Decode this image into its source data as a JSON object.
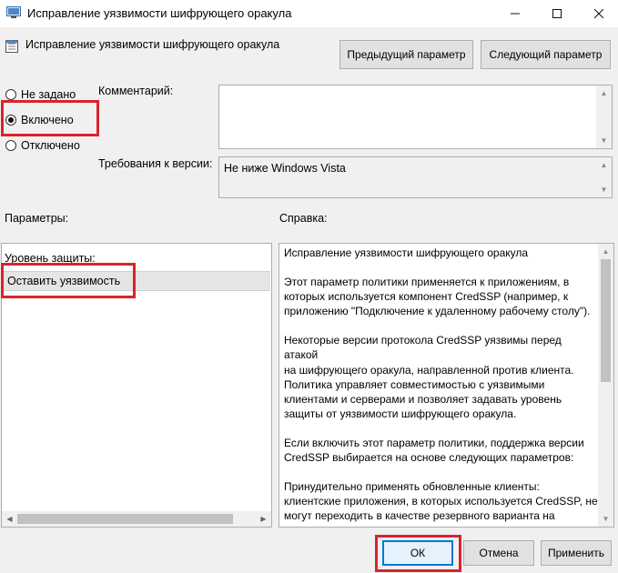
{
  "window": {
    "title": "Исправление уязвимости шифрующего оракула"
  },
  "header": {
    "title": "Исправление уязвимости шифрующего оракула",
    "prev_label": "Предыдущий параметр",
    "next_label": "Следующий параметр"
  },
  "state": {
    "options": [
      {
        "label": "Не задано",
        "checked": false
      },
      {
        "label": "Включено",
        "checked": true
      },
      {
        "label": "Отключено",
        "checked": false
      }
    ]
  },
  "comment": {
    "label": "Комментарий:",
    "value": ""
  },
  "requirements": {
    "label": "Требования к версии:",
    "value": "Не ниже Windows Vista"
  },
  "params": {
    "label": "Параметры:",
    "level_label": "Уровень защиты:",
    "level_value": "Оставить уязвимость"
  },
  "help": {
    "label": "Справка:",
    "paragraphs": [
      "Исправление уязвимости шифрующего оракула",
      "Этот параметр политики применяется к приложениям, в\nкоторых используется компонент CredSSP (например, к\nприложению \"Подключение к удаленному рабочему столу\").",
      "Некоторые версии протокола CredSSP уязвимы перед атакой\nна шифрующего оракула, направленной против клиента.\nПолитика управляет совместимостью с уязвимыми\nклиентами и серверами и позволяет задавать уровень\nзащиты от уязвимости шифрующего оракула.",
      "Если включить этот параметр политики, поддержка версии\nCredSSP выбирается на основе следующих параметров:",
      "Принудительно применять обновленные клиенты:\nклиентские приложения, в которых используется CredSSP, не\nмогут переходить в качестве резервного варианта на\nнебезопасные версии, и службы, где применяется CredSSP,\nне принимают неисправленные клиенты. Примечание. Этот"
    ]
  },
  "footer": {
    "ok_label": "ОК",
    "cancel_label": "Отмена",
    "apply_label": "Применить"
  },
  "colors": {
    "highlight": "#d9232d",
    "ok_border": "#0078d7"
  }
}
